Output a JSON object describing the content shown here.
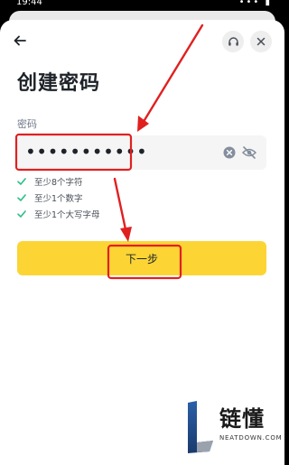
{
  "status_bar": {
    "time": "19:44",
    "icons": "••• ▮"
  },
  "header": {
    "back_icon": "arrow-left-icon",
    "support_icon": "headset-icon",
    "close_icon": "close-icon"
  },
  "page": {
    "title": "创建密码",
    "field_label": "密码",
    "password_masked": "•••••••••••",
    "rules": [
      {
        "text": "至少8个字符",
        "met": true
      },
      {
        "text": "至少1个数字",
        "met": true
      },
      {
        "text": "至少1个大写字母",
        "met": true
      }
    ],
    "next_button_label": "下一步"
  },
  "colors": {
    "accent": "#fcd535",
    "check": "#2ebd85",
    "annotation": "#e02020"
  },
  "watermark": {
    "brand": "链懂",
    "site": "NEATDOWN.COM"
  }
}
